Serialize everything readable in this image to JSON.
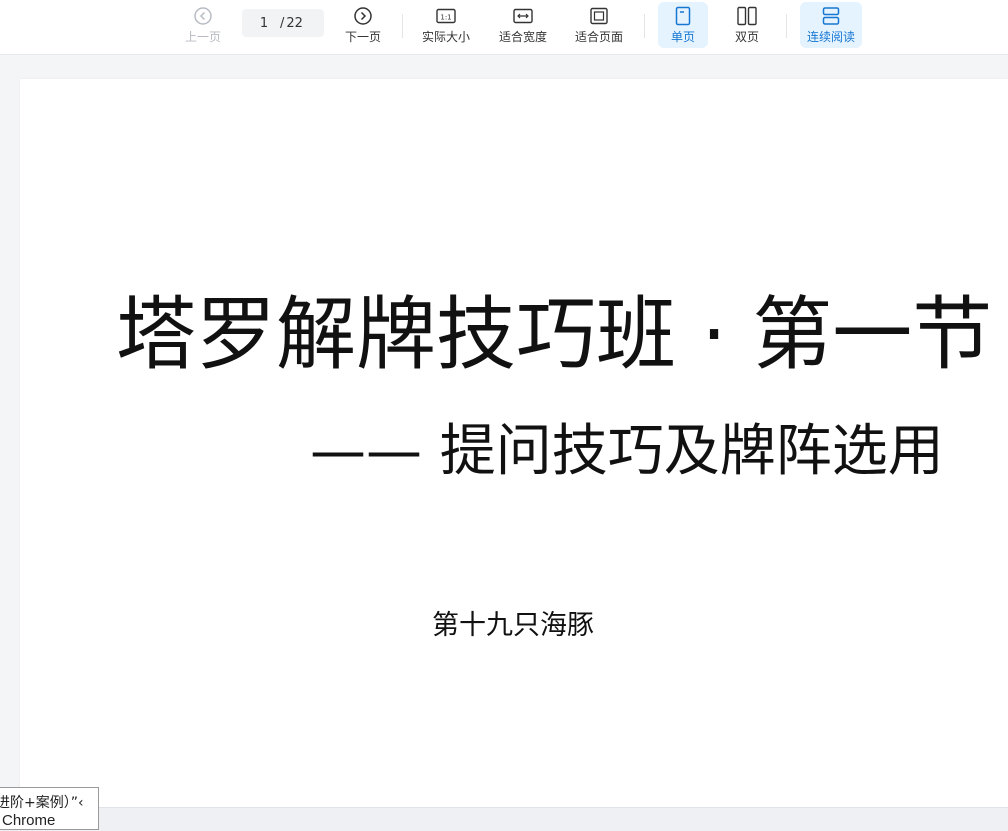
{
  "toolbar": {
    "prev_label": "上一页",
    "next_label": "下一页",
    "page_current": "1",
    "page_sep": "/",
    "page_total": "22",
    "actual_size_label": "实际大小",
    "actual_size_icon_text": "1:1",
    "fit_width_label": "适合宽度",
    "fit_page_label": "适合页面",
    "single_page_label": "单页",
    "double_page_label": "双页",
    "continuous_label": "连续阅读",
    "active_color": "#1677d2"
  },
  "document": {
    "title": "塔罗解牌技巧班 · 第一节",
    "subtitle": "—— 提问技巧及牌阵选用",
    "author": "第十九只海豚"
  },
  "tooltip": {
    "line1": "进阶+案例）”‹",
    "line2": "Chrome"
  }
}
